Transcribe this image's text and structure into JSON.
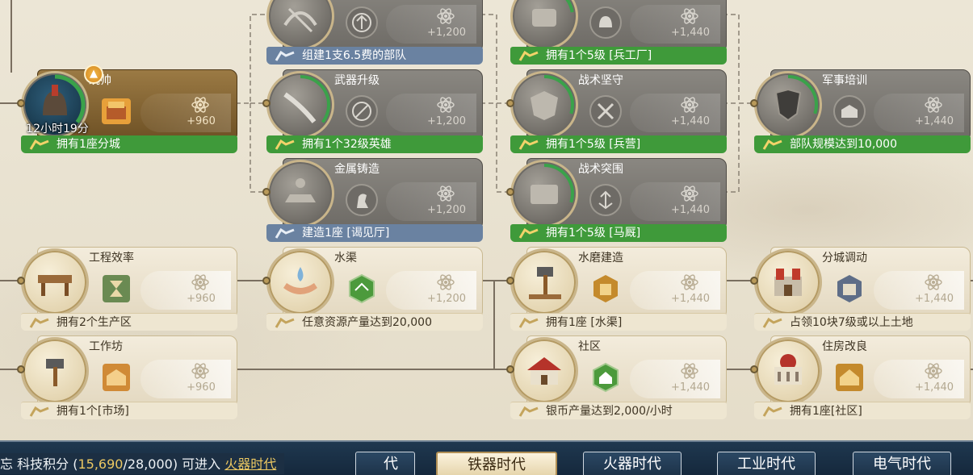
{
  "tech_tree": {
    "nodes": {
      "crossbow": {
        "subtitle": "组建1支6.5费的部队",
        "reward": "+1,200",
        "icon": "crossbow-icon",
        "badge_icon": "bow-icon",
        "status": "locked"
      },
      "gear_top": {
        "subtitle": "拥有1个5级 [兵工厂]",
        "reward": "+1,440",
        "icon": "armor-icon",
        "badge_icon": "helmet-icon",
        "status": "done"
      },
      "marshal": {
        "title": "统帅",
        "timer": "12小时19分",
        "subtitle": "拥有1座分城",
        "reward": "+960",
        "icon": "warrior-helmet-icon",
        "badge_icon": "barracks-icon",
        "status": "researching",
        "progress": 0.35
      },
      "weapon_upgrade": {
        "title": "武器升级",
        "subtitle": "拥有1个32级英雄",
        "reward": "+1,200",
        "icon": "sword-icon",
        "badge_icon": "blocked-icon",
        "status": "done",
        "progress": 0.35
      },
      "tactics_hold": {
        "title": "战术坚守",
        "subtitle": "拥有1个5级 [兵营]",
        "reward": "+1,440",
        "icon": "shield-armor-icon",
        "badge_icon": "sword-crossed-icon",
        "status": "done",
        "progress": 0.3
      },
      "military_training": {
        "title": "军事培训",
        "subtitle": "部队规模达到10,000",
        "reward": "+1,440",
        "icon": "shield-icon",
        "badge_icon": "building-icon",
        "status": "done",
        "progress": 0.3
      },
      "metal_casting": {
        "title": "金属铸造",
        "subtitle": "建造1座 [谒见厅]",
        "reward": "+1,200",
        "icon": "anvil-icon",
        "badge_icon": "horse-icon",
        "status": "locked"
      },
      "tactics_breakout": {
        "title": "战术突围",
        "subtitle": "拥有1个5级 [马厩]",
        "reward": "+1,440",
        "icon": "armor-plate-icon",
        "badge_icon": "arrows-icon",
        "status": "done",
        "progress": 0.3
      },
      "engineering": {
        "title": "工程效率",
        "subtitle": "拥有2个生产区",
        "reward": "+960",
        "icon": "workbench-icon",
        "badge_icon": "hourglass-icon"
      },
      "canal": {
        "title": "水渠",
        "subtitle": "任意资源产量达到20,000",
        "reward": "+1,200",
        "icon": "water-hands-icon",
        "badge_icon": "green-hex-icon"
      },
      "watermill": {
        "title": "水磨建造",
        "subtitle": "拥有1座 [水渠]",
        "reward": "+1,440",
        "icon": "hammer-icon",
        "badge_icon": "mill-icon"
      },
      "subcity_deploy": {
        "title": "分城调动",
        "subtitle": "占领10块7级或以上土地",
        "reward": "+1,440",
        "icon": "castle-icon",
        "badge_icon": "fort-icon"
      },
      "workshop": {
        "title": "工作坊",
        "subtitle": "拥有1个[市场]",
        "reward": "+960",
        "icon": "hammer-icon",
        "badge_icon": "market-icon"
      },
      "community": {
        "title": "社区",
        "subtitle": "银币产量达到2,000/小时",
        "reward": "+1,440",
        "icon": "house-icon",
        "badge_icon": "green-house-icon"
      },
      "housing": {
        "title": "住房改良",
        "subtitle": "拥有1座[社区]",
        "reward": "+1,440",
        "icon": "mansion-icon",
        "badge_icon": "cottage-icon"
      }
    }
  },
  "footer": {
    "tech_points_label": "科技积分",
    "tech_points_prefix": "(",
    "tech_points_current": "15,690",
    "tech_points_total": "/28,000)",
    "unlock_text": "可进入",
    "unlock_link": "火器时代",
    "prefix_glyph": "忘",
    "eras": [
      "代",
      "铁器时代",
      "火器时代",
      "工业时代",
      "电气时代"
    ],
    "active_era": "铁器时代"
  },
  "colors": {
    "done_bar": "#3f9a3a",
    "locked_bar": "#6a82a1",
    "accent_gold": "#ecc862",
    "progress_ring": "#3aa24a"
  }
}
